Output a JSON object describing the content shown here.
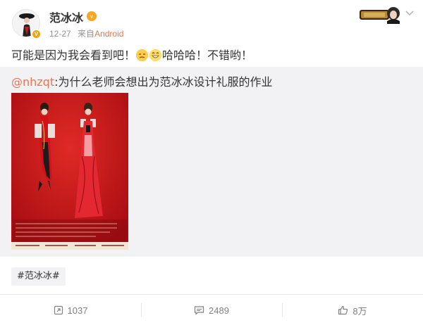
{
  "user": {
    "name": "范冰冰",
    "vip_badge": "v",
    "verified_mark": "V",
    "date": "12-27",
    "source_prefix": "来自",
    "source": "Android"
  },
  "post": {
    "text_before": "可能是因为我会看到吧！",
    "text_after": "哈哈哈！不错哟！",
    "emojis": [
      "smirk-emoji",
      "laugh-emoji"
    ]
  },
  "repost": {
    "mention": "@nhzqt",
    "text": ":为什么老师会想出为范冰冰设计礼服的作业"
  },
  "topic": "#范冰冰#",
  "actions": {
    "repost_count": "1037",
    "comment_count": "2489",
    "like_count": "8万"
  },
  "colors": {
    "accent": "#eb7350",
    "link": "#eb7350",
    "repost_bg": "#f2f2f5",
    "poster_red": "#c8141b"
  }
}
